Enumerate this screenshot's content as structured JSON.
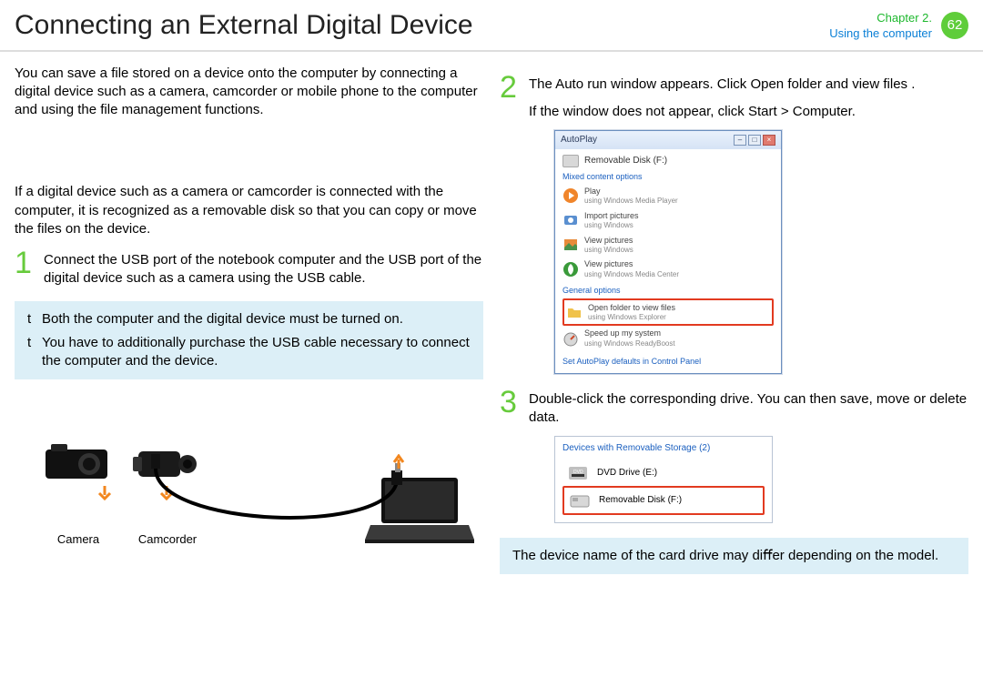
{
  "header": {
    "title": "Connecting an External Digital Device",
    "chapter": "Chapter 2.",
    "subtitle": "Using the computer",
    "page": "62"
  },
  "intro": "You can save a ﬁle stored on a device onto the computer by connecting a digital device such as a camera, camcorder or mobile phone to the computer and using the ﬁle management functions.",
  "connect_desc": "If a digital device such as a camera or camcorder is connected with the computer, it is recognized as a removable disk so that you can copy or move the ﬁles on the device.",
  "step1": {
    "num": "1",
    "text": "Connect the USB port of the notebook computer and the USB port of the digital device such as a camera using the USB cable."
  },
  "notes": {
    "a": "Both the computer and the digital device must be turned on.",
    "b": "You have to additionally purchase the USB cable necessary to connect the computer and the device."
  },
  "bullet": "t",
  "devices": {
    "camera": "Camera",
    "camcorder": "Camcorder"
  },
  "step2": {
    "num": "2",
    "text": "The Auto run window appears. Click Open folder and view ﬁles .",
    "sub": "If the window does not appear, click Start > Computer."
  },
  "autoplay": {
    "title": "AutoPlay",
    "drive": "Removable Disk (F:)",
    "sec1": "Mixed content options",
    "opts": {
      "play": "Play",
      "play_sub": "using Windows Media Player",
      "import": "Import pictures",
      "import_sub": "using Windows",
      "view1": "View pictures",
      "view1_sub": "using Windows",
      "view2": "View pictures",
      "view2_sub": "using Windows Media Center"
    },
    "sec2": "General options",
    "open": "Open folder to view files",
    "open_sub": "using Windows Explorer",
    "speed": "Speed up my system",
    "speed_sub": "using Windows ReadyBoost",
    "link": "Set AutoPlay defaults in Control Panel"
  },
  "step3": {
    "num": "3",
    "text": "Double-click the corresponding drive. You can then save, move or delete data."
  },
  "drives": {
    "head": "Devices with Removable Storage (2)",
    "dvd": "DVD Drive (E:)",
    "rem": "Removable Disk (F:)"
  },
  "footnote": "The device name of the card drive may diﬀer depending on the model."
}
